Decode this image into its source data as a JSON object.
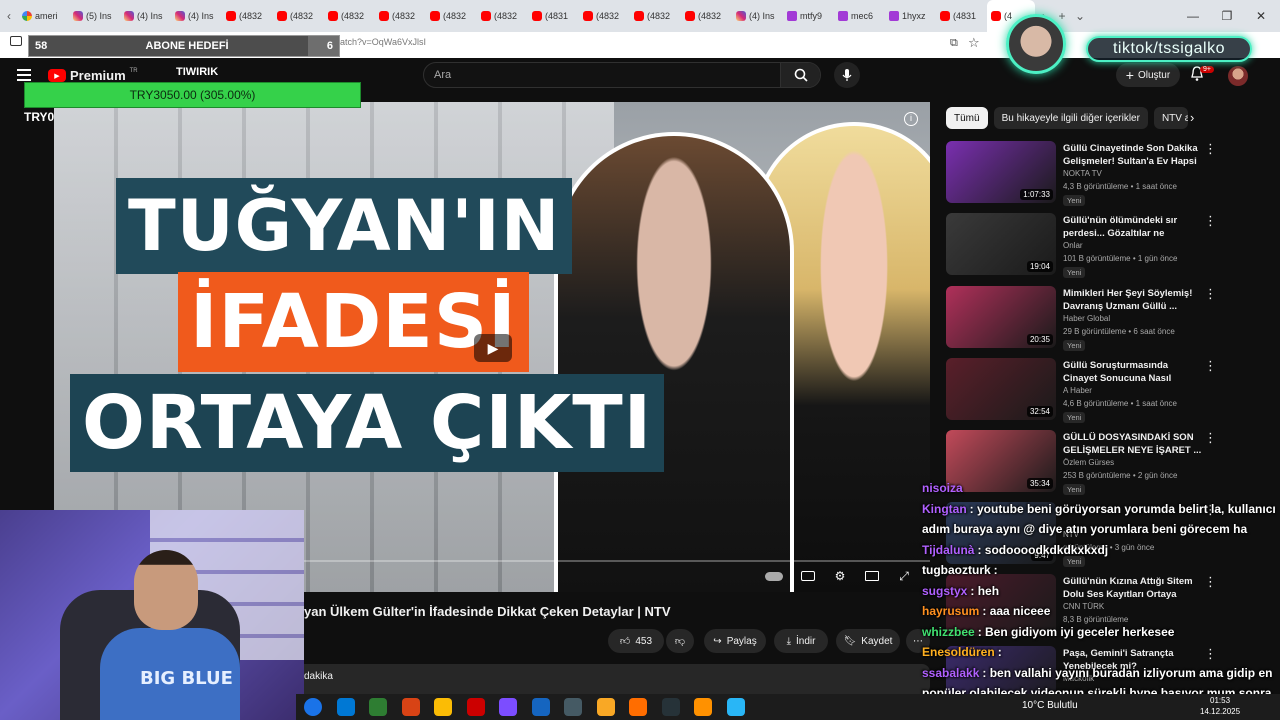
{
  "browser": {
    "tabs": [
      {
        "label": "ameri",
        "icon": "google"
      },
      {
        "label": "(5) Ins",
        "icon": "instagram"
      },
      {
        "label": "(4) Ins",
        "icon": "instagram"
      },
      {
        "label": "(4) Ins",
        "icon": "instagram"
      },
      {
        "label": "(4832",
        "icon": "youtube"
      },
      {
        "label": "(4832",
        "icon": "youtube"
      },
      {
        "label": "(4832",
        "icon": "youtube"
      },
      {
        "label": "(4832",
        "icon": "youtube"
      },
      {
        "label": "(4832",
        "icon": "youtube"
      },
      {
        "label": "(4832",
        "icon": "youtube"
      },
      {
        "label": "(4831",
        "icon": "youtube"
      },
      {
        "label": "(4832",
        "icon": "youtube"
      },
      {
        "label": "(4832",
        "icon": "youtube"
      },
      {
        "label": "(4832",
        "icon": "youtube"
      },
      {
        "label": "(4) Ins",
        "icon": "instagram"
      },
      {
        "label": "mtfy9",
        "icon": "twitch"
      },
      {
        "label": "mec6",
        "icon": "twitch"
      },
      {
        "label": "1hyxz",
        "icon": "twitch"
      },
      {
        "label": "(4831",
        "icon": "youtube"
      },
      {
        "label": "(4",
        "icon": "youtube"
      }
    ],
    "url_fragment": "atch?v=OqWa6VxJlsI"
  },
  "youtube": {
    "logo_text": "Premium",
    "logo_region": "TR",
    "search_placeholder": "Ara",
    "create_label": "Oluştur",
    "notification_count": "9+"
  },
  "stream_overlay": {
    "goal_current": "58",
    "goal_label": "ABONE HEDEFİ",
    "goal_target": "6",
    "goal_fraction": 0.9,
    "donation_text": "TRY3050.00 (305.00%)",
    "tiwirik_label": "TIWIRIK",
    "try_label": "TRY0",
    "tiktok_handle": "tiktok/tssigalko"
  },
  "video": {
    "thumbnail_lines": [
      "TUĞYAN'IN",
      "İFADESİ",
      "ORTAYA ÇIKTI"
    ],
    "title": "yan Ülkem Gülter'in İfadesinde Dikkat Çeken Detaylar | NTV",
    "like_count": "453",
    "share_label": "Paylaş",
    "download_label": "İndir",
    "save_label": "Kaydet",
    "description_fragment": "dakika"
  },
  "sidebar": {
    "chips": [
      "Tümü",
      "Bu hikayeyle ilgili diğer içerikler",
      "NTV a"
    ],
    "recommendations": [
      {
        "title": "Güllü Cinayetinde Son Dakika Gelişmeler! Sultan'a Ev Hapsi ...",
        "channel": "NOKTA TV",
        "meta": "4,3 B görüntüleme • 1 saat önce",
        "badge": "Yeni",
        "duration": "1:07:33",
        "thumb_color": "#7a2fb0"
      },
      {
        "title": "Güllü'nün ölümündeki sır perdesi... Gözaltılar ne anlama...",
        "channel": "Onlar",
        "meta": "101 B görüntüleme • 1 gün önce",
        "badge": "Yeni",
        "duration": "19:04",
        "thumb_color": "#3a3a3a"
      },
      {
        "title": "Mimikleri Her Şeyi Söylemiş! Davranış Uzmanı Güllü ...",
        "channel": "Haber Global",
        "meta": "29 B görüntüleme • 6 saat önce",
        "badge": "Yeni",
        "duration": "20:35",
        "thumb_color": "#b0305a"
      },
      {
        "title": "Güllü Soruşturmasında Cinayet Sonucuna Nasıl Ulaşıldı, Süreç...",
        "channel": "A Haber",
        "meta": "4,6 B görüntüleme • 1 saat önce",
        "badge": "Yeni",
        "duration": "32:54",
        "thumb_color": "#5a1f2a"
      },
      {
        "title": "GÜLLÜ DOSYASINDAKİ SON GELİŞMELER NEYE İŞARET ...",
        "channel": "Özlem Gürses",
        "meta": "253 B görüntüleme • 2 gün önce",
        "badge": "Yeni",
        "duration": "35:34",
        "thumb_color": "#c24a5a"
      },
      {
        "title": "",
        "channel": "NTV",
        "meta": "görüntüleme • 3 gün önce",
        "badge": "Yeni",
        "duration": "9:47",
        "thumb_color": "#2a3a5a"
      },
      {
        "title": "Güllü'nün Kızına Attığı Sitem Dolu Ses Kayıtları Ortaya Çıktı!...",
        "channel": "CNN TÜRK",
        "meta": "8,3 B görüntüleme",
        "badge": "",
        "duration": "",
        "thumb_color": "#4a1a2a"
      },
      {
        "title": "Paşa, Gemini'i Satrançta Yenebilecek mi?",
        "channel": "Mackolik",
        "meta": "",
        "badge": "",
        "duration": "",
        "thumb_color": "#3a2a6a"
      }
    ]
  },
  "chat": [
    {
      "user": "nisoiza",
      "msg": "",
      "color": "#b060ff"
    },
    {
      "user": "Kingtan",
      "msg": ": youtube beni görüyorsan yorumda belirt la, kullanıcı",
      "color": "#b060ff"
    },
    {
      "user": "",
      "msg": "adım buraya aynı @ diye atın yorumlara beni görecem ha",
      "color": "#ffffff"
    },
    {
      "user": "Tijdalunà",
      "msg": ": sodoooodkdkdkxkxdj",
      "color": "#b060ff"
    },
    {
      "user": "tugbaozturk",
      "msg": ":",
      "color": "#ffffff"
    },
    {
      "user": "sugstyx",
      "msg": ": heh",
      "color": "#b060ff"
    },
    {
      "user": "hayrusum",
      "msg": ": aaa niceee",
      "color": "#ff9020"
    },
    {
      "user": "whizzbee",
      "msg": ": Ben gidiyom iyi geceler herkesee",
      "color": "#40e070"
    },
    {
      "user": "Enesoldüren",
      "msg": ":",
      "color": "#ffb020"
    },
    {
      "user": "ssabalakk",
      "msg": ": ben vallahi yayını buradan izliyorum ama gidip en",
      "color": "#b060ff"
    },
    {
      "user": "",
      "msg": "popüler olabilecek videonun sürekli hype basıyor mum sonra",
      "color": "#ffffff"
    }
  ],
  "webcam": {
    "shirt_text": "BIG BLUE"
  },
  "taskbar": {
    "weather": "10°C  Bulutlu",
    "time": "01:53",
    "date": "14.12.2025"
  }
}
